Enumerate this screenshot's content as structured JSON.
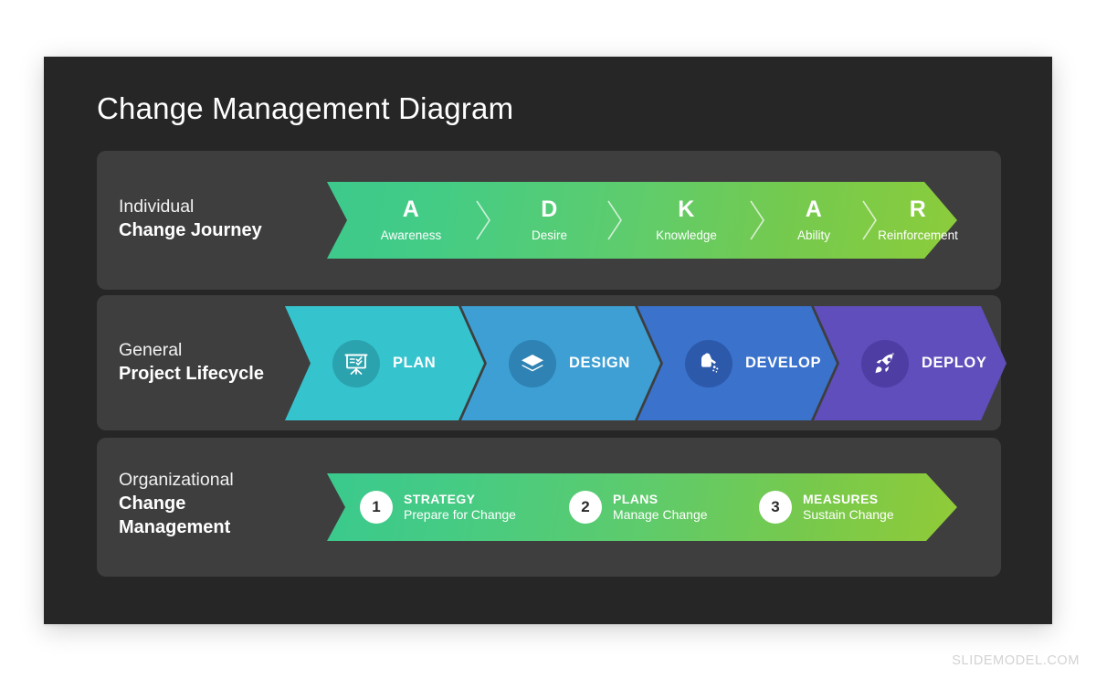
{
  "slide": {
    "title": "Change Management Diagram",
    "background_color": "#262626",
    "panel_color": "#3e3e3e",
    "footer": "SLIDEMODEL.COM"
  },
  "rows": [
    {
      "label_line1": "Individual",
      "label_line2": "Change Journey",
      "gradient_from": "#3dc98c",
      "gradient_to": "#8ccc3b",
      "steps": [
        {
          "letter": "A",
          "word": "Awareness"
        },
        {
          "letter": "D",
          "word": "Desire"
        },
        {
          "letter": "K",
          "word": "Knowledge"
        },
        {
          "letter": "A",
          "word": "Ability"
        },
        {
          "letter": "R",
          "word": "Reinforcement"
        }
      ]
    },
    {
      "label_line1": "General",
      "label_line2": "Project Lifecycle",
      "steps": [
        {
          "name": "PLAN",
          "icon": "presentation-board-icon",
          "color": "#35c3ce",
          "icon_bg": "#2ba3ae"
        },
        {
          "name": "DESIGN",
          "icon": "layers-icon",
          "color": "#3d9fd4",
          "icon_bg": "#2e82b4"
        },
        {
          "name": "DEVELOP",
          "icon": "watering-can-icon",
          "color": "#3a72cc",
          "icon_bg": "#2d59ab"
        },
        {
          "name": "DEPLOY",
          "icon": "rocket-icon",
          "color": "#5f4ebb",
          "icon_bg": "#4e3da2"
        }
      ]
    },
    {
      "label_line1": "Organizational",
      "label_line2": "Change",
      "label_line3": "Management",
      "gradient_from": "#3ac98d",
      "gradient_to": "#91cb38",
      "steps": [
        {
          "num": "1",
          "title": "STRATEGY",
          "sub": "Prepare for Change"
        },
        {
          "num": "2",
          "title": "PLANS",
          "sub": "Manage Change"
        },
        {
          "num": "3",
          "title": "MEASURES",
          "sub": "Sustain Change"
        }
      ]
    }
  ]
}
